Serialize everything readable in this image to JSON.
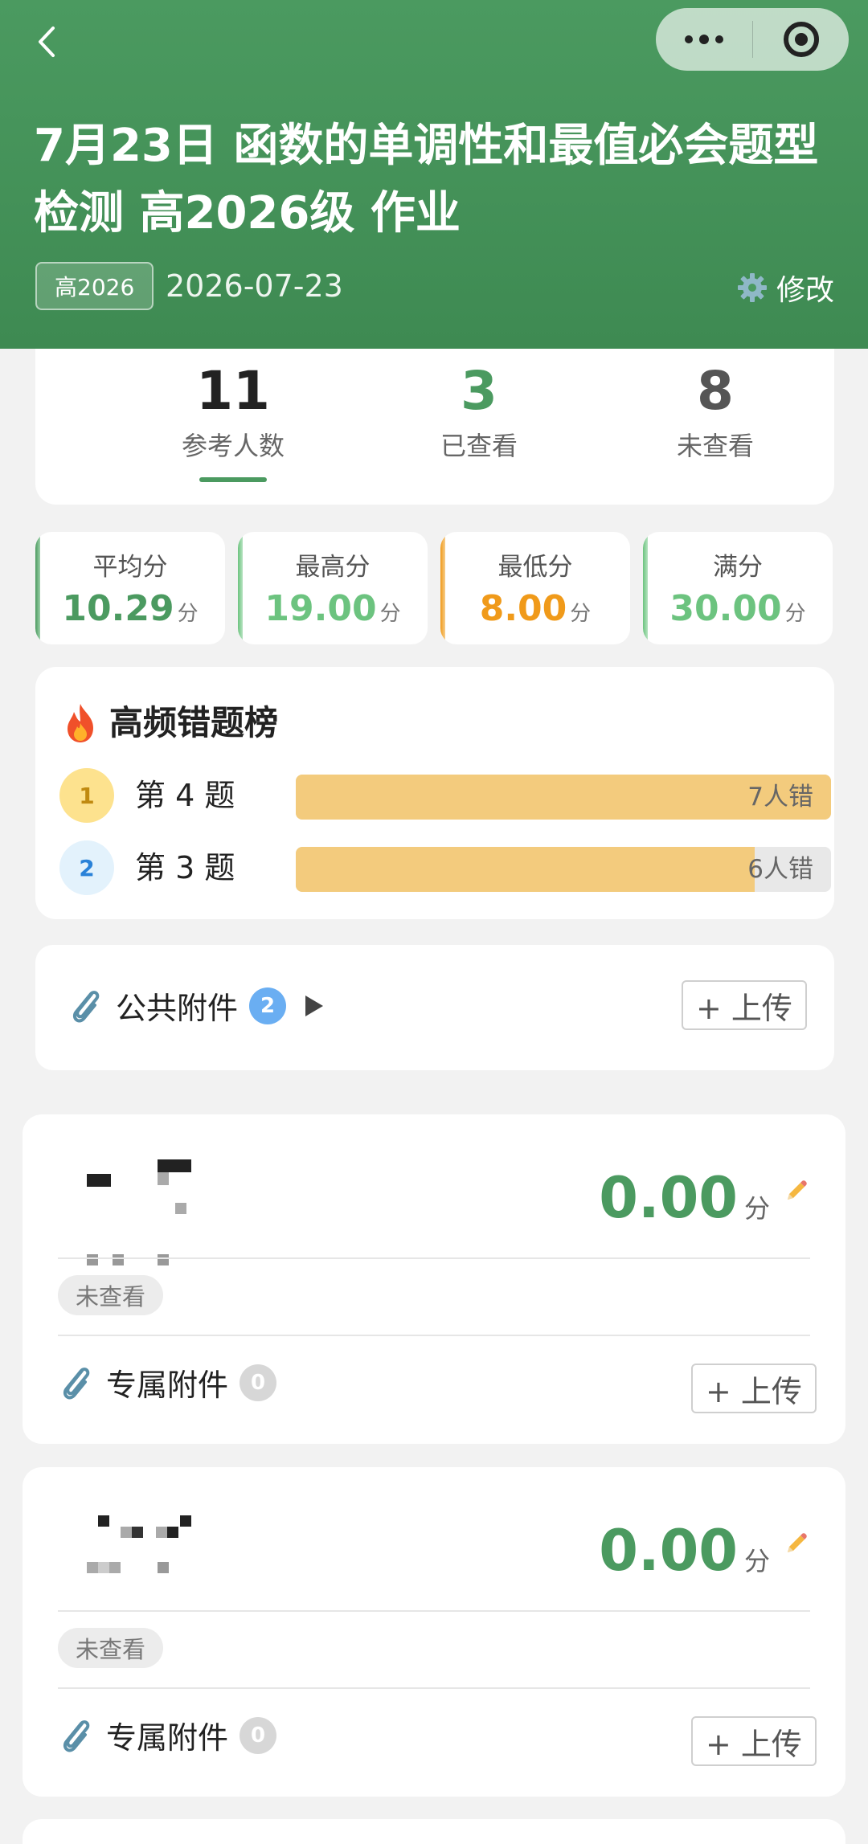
{
  "header": {
    "title": "7月23日 函数的单调性和最值必会题型检测 高2026级 作业",
    "tag": "高2026",
    "date": "2026-07-23",
    "edit_label": "修改"
  },
  "stats": [
    {
      "value": "11",
      "label": "参考人数",
      "color": "#222222"
    },
    {
      "value": "3",
      "label": "已查看",
      "color": "#4b9a60"
    },
    {
      "value": "8",
      "label": "未查看",
      "color": "#555555"
    }
  ],
  "scores": [
    {
      "label": "平均分",
      "value": "10.29",
      "unit": "分",
      "color": "#4b9a60"
    },
    {
      "label": "最高分",
      "value": "19.00",
      "unit": "分",
      "color": "#6cc37f"
    },
    {
      "label": "最低分",
      "value": "8.00",
      "unit": "分",
      "color": "#f09a1a"
    },
    {
      "label": "满分",
      "value": "30.00",
      "unit": "分",
      "color": "#6cc37f"
    }
  ],
  "wrong_rank": {
    "title": "高频错题榜",
    "items": [
      {
        "rank": "1",
        "label": "第 4 题",
        "count_label": "7人错",
        "count": 7
      },
      {
        "rank": "2",
        "label": "第 3 题",
        "count_label": "6人错",
        "count": 6
      }
    ]
  },
  "public_attachments": {
    "label": "公共附件",
    "count": "2",
    "upload_label": "+ 上传"
  },
  "students": [
    {
      "score": "0.00",
      "unit": "分",
      "status": "未查看",
      "attach_label": "专属附件",
      "attach_count": "0",
      "upload_label": "+ 上传"
    },
    {
      "score": "0.00",
      "unit": "分",
      "status": "未查看",
      "attach_label": "专属附件",
      "attach_count": "0",
      "upload_label": "+ 上传"
    }
  ],
  "colors": {
    "primary": "#4b9a60",
    "bar_fill": "#f3cb7d",
    "badge_blue": "#6aaef2"
  }
}
